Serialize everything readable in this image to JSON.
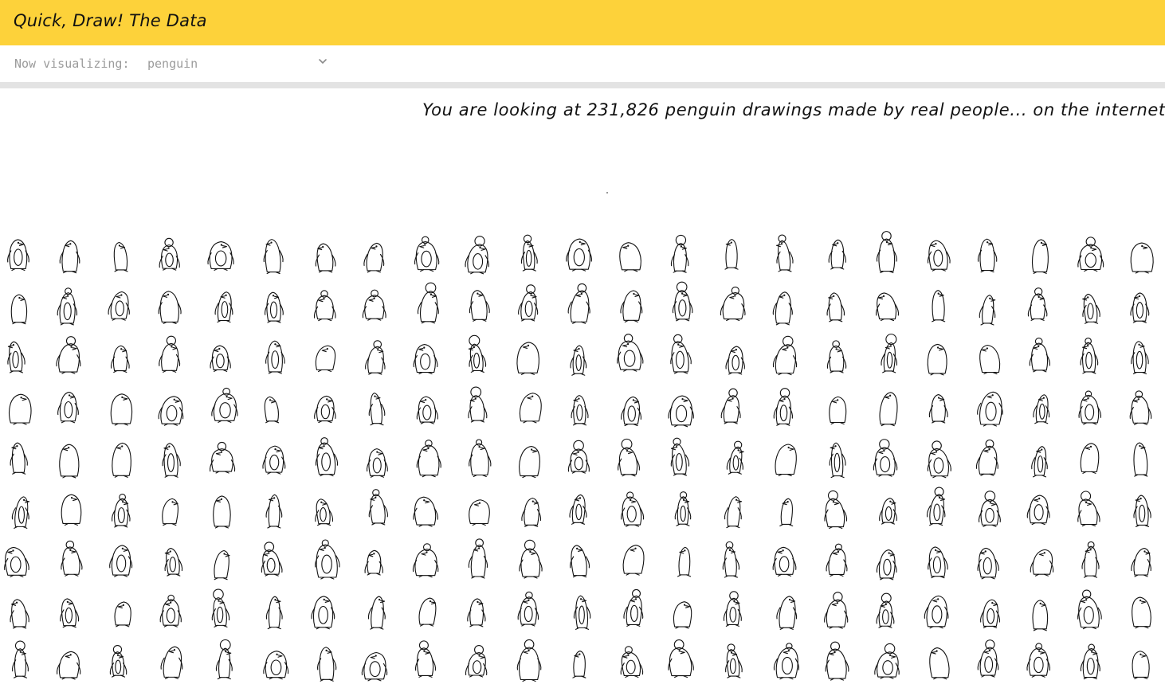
{
  "header": {
    "title": "Quick, Draw! The Data"
  },
  "selector": {
    "label": "Now visualizing:",
    "value": "penguin",
    "chevron_icon": "chevron-down-icon"
  },
  "headline": "You are looking at 231,826 penguin drawings made by real people... on the internet.",
  "drawing_count": 231826,
  "category": "penguin",
  "grid": {
    "rows": 9,
    "columns": 23,
    "drawing_icon": "penguin-doodle-icon"
  },
  "colors": {
    "header": "#fdd23a",
    "divider": "#e3e3e3",
    "ink": "#111111",
    "muted": "#9b9b9b"
  }
}
